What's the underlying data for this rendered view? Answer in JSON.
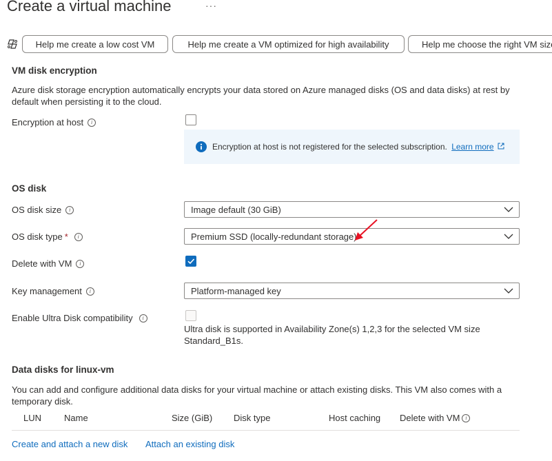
{
  "page": {
    "title": "Create a virtual machine",
    "more": "···"
  },
  "copilot_buttons": [
    {
      "label": "Help me create a low cost VM"
    },
    {
      "label": "Help me create a VM optimized for high availability"
    },
    {
      "label": "Help me choose the right VM size"
    }
  ],
  "encryption": {
    "heading": "VM disk encryption",
    "description": "Azure disk storage encryption automatically encrypts your data stored on Azure managed disks (OS and data disks) at rest by default when persisting it to the cloud.",
    "host_label": "Encryption at host",
    "host_checked": false,
    "info_text": "Encryption at host is not registered for the selected subscription.",
    "learn_more": "Learn more"
  },
  "os_disk": {
    "heading": "OS disk",
    "size_label": "OS disk size",
    "size_value": "Image default (30 GiB)",
    "type_label": "OS disk type",
    "type_required": "*",
    "type_value": "Premium SSD (locally-redundant storage)",
    "delete_label": "Delete with VM",
    "delete_checked": true,
    "key_label": "Key management",
    "key_value": "Platform-managed key",
    "ultra_label": "Enable Ultra Disk compatibility",
    "ultra_checked": false,
    "ultra_note": "Ultra disk is supported in Availability Zone(s) 1,2,3 for the selected VM size Standard_B1s."
  },
  "data_disks": {
    "heading": "Data disks for linux-vm",
    "description": "You can add and configure additional data disks for your virtual machine or attach existing disks. This VM also comes with a temporary disk.",
    "columns": {
      "lun": "LUN",
      "name": "Name",
      "size": "Size (GiB)",
      "type": "Disk type",
      "caching": "Host caching",
      "delete": "Delete with VM"
    },
    "create_link": "Create and attach a new disk",
    "attach_link": "Attach an existing disk"
  },
  "colors": {
    "accent": "#0f6cbd",
    "annotation_arrow": "#e81123",
    "info_bg": "#eff6fc"
  }
}
